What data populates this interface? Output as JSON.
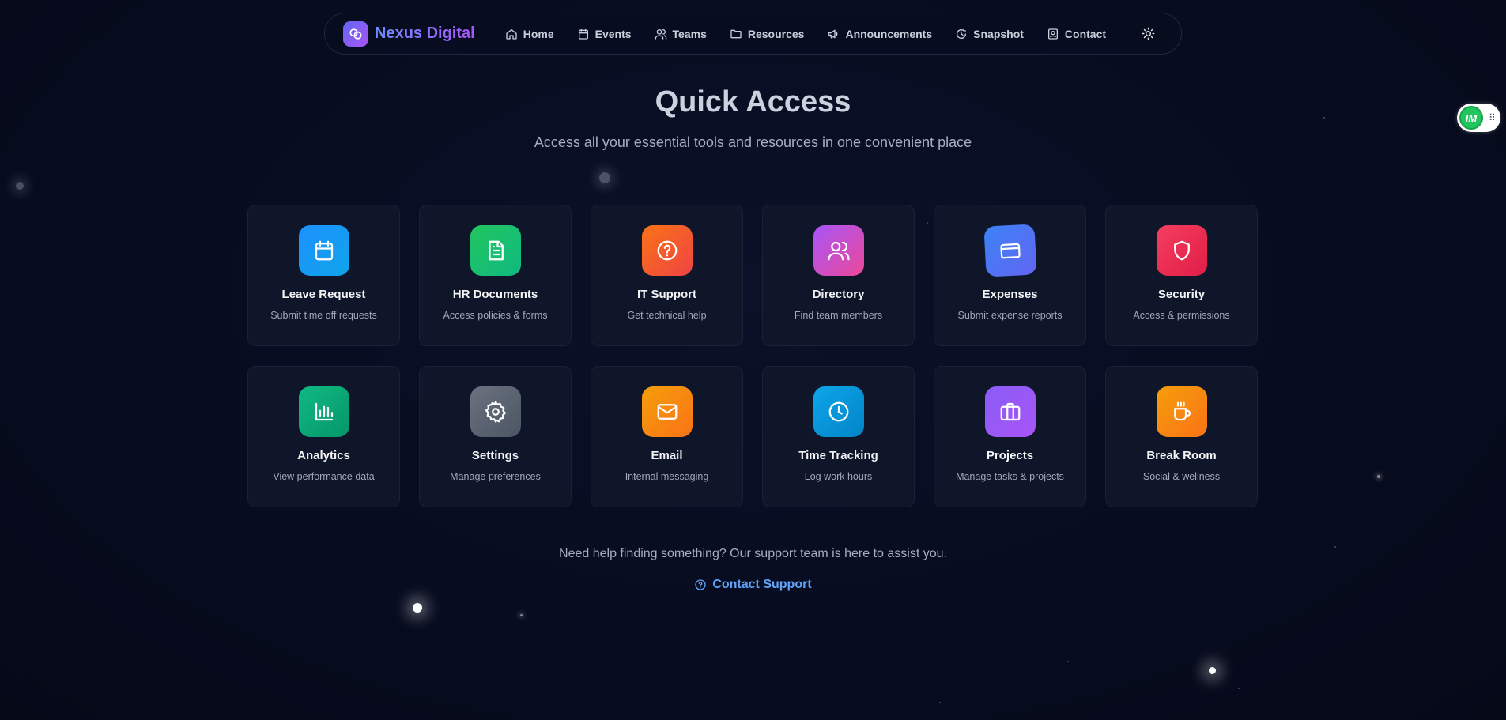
{
  "brand": {
    "name": "Nexus Digital",
    "logo_icon": "linked-circles-icon"
  },
  "nav": {
    "items": [
      {
        "label": "Home",
        "icon": "home-icon"
      },
      {
        "label": "Events",
        "icon": "calendar-icon"
      },
      {
        "label": "Teams",
        "icon": "users-icon"
      },
      {
        "label": "Resources",
        "icon": "folder-icon"
      },
      {
        "label": "Announcements",
        "icon": "megaphone-icon"
      },
      {
        "label": "Snapshot",
        "icon": "snapshot-icon"
      },
      {
        "label": "Contact",
        "icon": "contact-icon"
      }
    ],
    "theme_toggle_icon": "sun-icon"
  },
  "widget": {
    "badge_text": "IM",
    "grip_icon": "drag-grip-icon"
  },
  "hero": {
    "title": "Quick Access",
    "subtitle": "Access all your essential tools and resources in one convenient place"
  },
  "cards": [
    {
      "title": "Leave Request",
      "desc": "Submit time off requests",
      "icon": "calendar-icon",
      "colors": [
        "#1e90ff",
        "#0ea5e9"
      ]
    },
    {
      "title": "HR Documents",
      "desc": "Access policies & forms",
      "icon": "document-icon",
      "colors": [
        "#22c55e",
        "#10b981"
      ]
    },
    {
      "title": "IT Support",
      "desc": "Get technical help",
      "icon": "help-circle-icon",
      "colors": [
        "#f97316",
        "#ef4444"
      ]
    },
    {
      "title": "Directory",
      "desc": "Find team members",
      "icon": "users-icon",
      "colors": [
        "#a855f7",
        "#ec4899"
      ]
    },
    {
      "title": "Expenses",
      "desc": "Submit expense reports",
      "icon": "credit-card-icon",
      "colors": [
        "#3b82f6",
        "#6366f1"
      ]
    },
    {
      "title": "Security",
      "desc": "Access & permissions",
      "icon": "shield-icon",
      "colors": [
        "#f43f5e",
        "#e11d48"
      ]
    },
    {
      "title": "Analytics",
      "desc": "View performance data",
      "icon": "bar-chart-icon",
      "colors": [
        "#10b981",
        "#059669"
      ]
    },
    {
      "title": "Settings",
      "desc": "Manage preferences",
      "icon": "gear-icon",
      "colors": [
        "#6b7280",
        "#4b5563"
      ]
    },
    {
      "title": "Email",
      "desc": "Internal messaging",
      "icon": "mail-icon",
      "colors": [
        "#f59e0b",
        "#f97316"
      ]
    },
    {
      "title": "Time Tracking",
      "desc": "Log work hours",
      "icon": "clock-icon",
      "colors": [
        "#0ea5e9",
        "#0284c7"
      ]
    },
    {
      "title": "Projects",
      "desc": "Manage tasks & projects",
      "icon": "briefcase-icon",
      "colors": [
        "#8b5cf6",
        "#a855f7"
      ]
    },
    {
      "title": "Break Room",
      "desc": "Social & wellness",
      "icon": "coffee-icon",
      "colors": [
        "#f59e0b",
        "#f97316"
      ]
    }
  ],
  "footer": {
    "help_text": "Need help finding something? Our support team is here to assist you.",
    "support_label": "Contact Support",
    "support_icon": "help-circle-icon",
    "link_color": "#60a5fa"
  }
}
